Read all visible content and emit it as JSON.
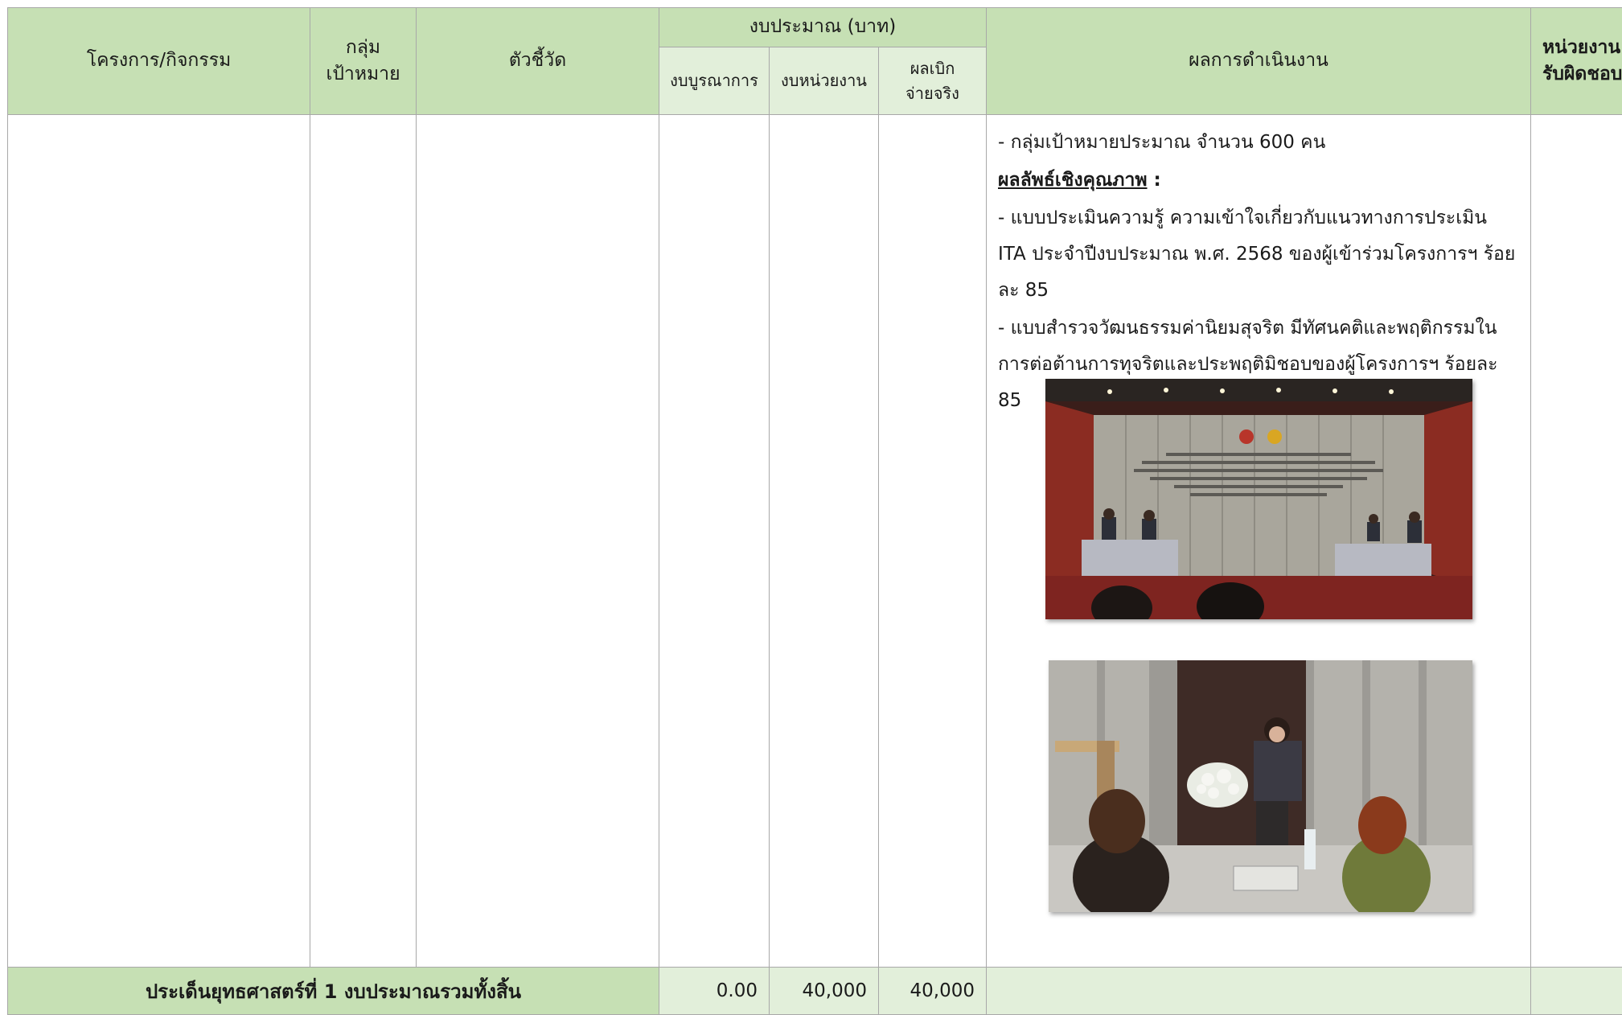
{
  "header": {
    "project": "โครงการ/กิจกรรม",
    "target_group_line1": "กลุ่ม",
    "target_group_line2": "เป้าหมาย",
    "indicator": "ตัวชี้วัด",
    "budget": "งบประมาณ (บาท)",
    "budget_integrated": "งบบูรณาการ",
    "budget_unit": "งบหน่วยงาน",
    "disbursed_line1": "ผลเบิก",
    "disbursed_line2": "จ่ายจริง",
    "results": "ผลการดำเนินงาน",
    "responsible_line1": "หน่วยงาน",
    "responsible_line2": "รับผิดชอบ"
  },
  "results": {
    "target_count": "- กลุ่มเป้าหมายประมาณ จำนวน 600 คน",
    "qualitative_heading": "ผลลัพธ์เชิงคุณภาพ",
    "qualitative_colon": " :",
    "item1": "- แบบประเมินความรู้ ความเข้าใจเกี่ยวกับแนวทางการประเมิน ITA ประจำปีงบประมาณ พ.ศ. 2568 ของผู้เข้าร่วมโครงการฯ ร้อยละ 85",
    "item2": "- แบบสำรวจวัฒนธรรมค่านิยมสุจริต มีทัศนคติและพฤติกรรมในการต่อต้านการทุจริตและประพฤติมิชอบของผู้โครงการฯ ร้อยละ 85"
  },
  "footer": {
    "label": "ประเด็นยุทธศาสตร์ที่ 1 งบประมาณรวมทั้งสิ้น",
    "integrated": "0.00",
    "unit": "40,000",
    "disbursed": "40,000"
  },
  "colors": {
    "header_green": "#c6e0b4",
    "sub_header_green": "#e2efda",
    "border": "#a8a8a8"
  }
}
